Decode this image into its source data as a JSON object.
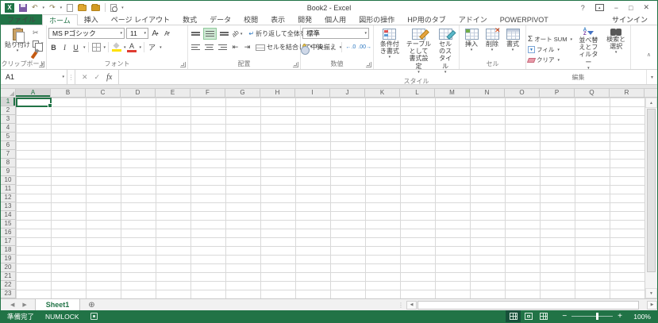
{
  "window": {
    "title": "Book2 - Excel",
    "signin": "サインイン"
  },
  "icons": {
    "dropdown": "▾",
    "undo": "↶",
    "redo": "↷",
    "scissors": "✂",
    "cancel": "✕",
    "enter": "✓",
    "fx": "fx",
    "sigma": "Σ",
    "up": "▲",
    "down": "▼",
    "left": "◀",
    "right": "▶",
    "collapse": "∧",
    "new_sheet": "⊕",
    "splitter": "⋮",
    "help": "?",
    "minimize": "−",
    "maximize": "□",
    "close": "✕",
    "ribbon_options": "▴",
    "wrap_arrow": "↵",
    "orientation": "ab",
    "outdent": "⇤",
    "indent": "⇥",
    "fill_arrow": "▼",
    "inc_decimal": "←.0",
    "dec_decimal": ".00→"
  },
  "file_tab": "ファイル",
  "tabs": [
    {
      "label": "ホーム",
      "active": true
    },
    {
      "label": "挿入"
    },
    {
      "label": "ページ レイアウト"
    },
    {
      "label": "数式"
    },
    {
      "label": "データ"
    },
    {
      "label": "校閲"
    },
    {
      "label": "表示"
    },
    {
      "label": "開発"
    },
    {
      "label": "個人用"
    },
    {
      "label": "図形の操作"
    },
    {
      "label": "HP用のタブ"
    },
    {
      "label": "アドイン"
    },
    {
      "label": "POWERPIVOT"
    }
  ],
  "ribbon": {
    "clipboard": {
      "paste": "貼り付け",
      "label": "クリップボード"
    },
    "font": {
      "name": "MS Pゴシック",
      "size": "11",
      "bold": "B",
      "italic": "I",
      "underline": "U",
      "grow": "A",
      "shrink": "A",
      "color_letter": "A",
      "phonetic": "ア",
      "label": "フォント"
    },
    "alignment": {
      "wrap": "折り返して全体を表示する",
      "merge": "セルを結合して中央揃え",
      "label": "配置"
    },
    "number": {
      "format": "標準",
      "percent": "%",
      "comma": ",",
      "label": "数値"
    },
    "styles": {
      "conditional": "条件付き書式",
      "table": "テーブルとして書式設定",
      "cell": "セルのスタイル",
      "label": "スタイル"
    },
    "cells": {
      "insert": "挿入",
      "delete": "削除",
      "format": "書式",
      "label": "セル"
    },
    "editing": {
      "autosum": "オート SUM",
      "fill": "フィル",
      "clear": "クリア",
      "sort": "並べ替えとフィルター",
      "find": "検索と選択",
      "label": "編集"
    }
  },
  "formula_bar": {
    "name_box": "A1",
    "value": ""
  },
  "grid": {
    "columns": [
      "A",
      "B",
      "C",
      "D",
      "E",
      "F",
      "G",
      "H",
      "I",
      "J",
      "K",
      "L",
      "M",
      "N",
      "O",
      "P",
      "Q",
      "R"
    ],
    "rows": [
      "1",
      "2",
      "3",
      "4",
      "5",
      "6",
      "7",
      "8",
      "9",
      "10",
      "11",
      "12",
      "13",
      "14",
      "15",
      "16",
      "17",
      "18",
      "19",
      "20",
      "21",
      "22",
      "23"
    ],
    "selected_column": "A",
    "selected_row": "1",
    "selected_cell": "A1"
  },
  "sheet_bar": {
    "sheets": [
      {
        "label": "Sheet1",
        "active": true
      }
    ]
  },
  "status_bar": {
    "ready": "準備完了",
    "numlock": "NUMLOCK",
    "zoom_level": "100%"
  }
}
